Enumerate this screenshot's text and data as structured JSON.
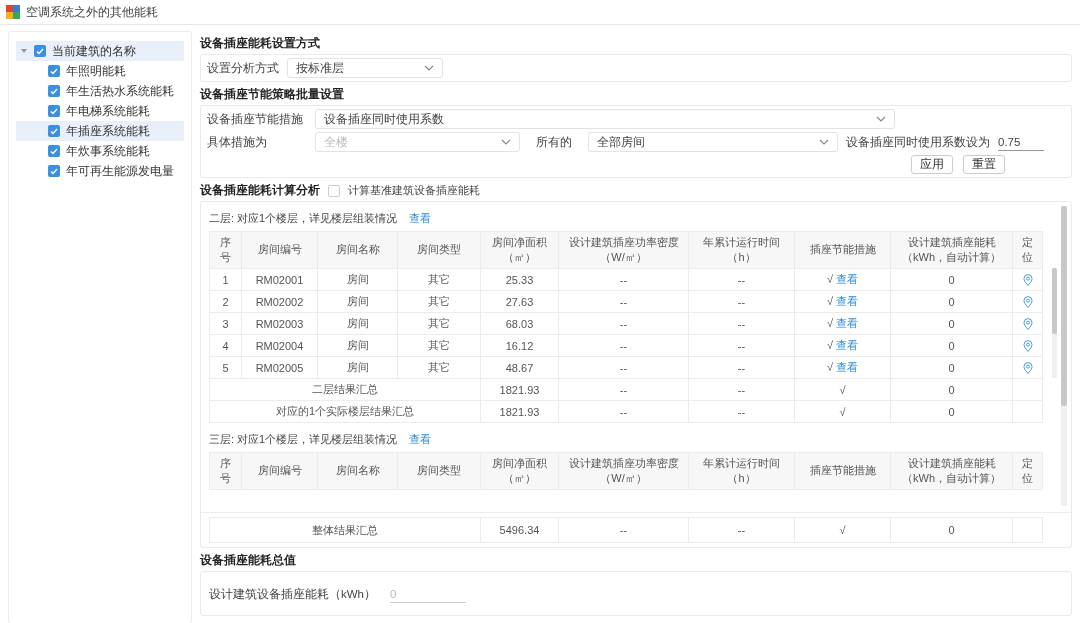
{
  "window": {
    "title": "空调系统之外的其他能耗"
  },
  "tree": {
    "label": "当前建筑的名称",
    "checked": true,
    "expanded": true,
    "selected": true,
    "children": [
      {
        "label": "年照明能耗",
        "checked": true,
        "selected": false
      },
      {
        "label": "年生活热水系统能耗",
        "checked": true,
        "selected": false
      },
      {
        "label": "年电梯系统能耗",
        "checked": true,
        "selected": false
      },
      {
        "label": "年插座系统能耗",
        "checked": true,
        "selected": true
      },
      {
        "label": "年炊事系统能耗",
        "checked": true,
        "selected": false
      },
      {
        "label": "年可再生能源发电量",
        "checked": true,
        "selected": false
      }
    ]
  },
  "setting_mode": {
    "title": "设备插座能耗设置方式",
    "label": "设置分析方式",
    "value": "按标准层"
  },
  "batch": {
    "title": "设备插座节能策略批量设置",
    "measure_label": "设备插座节能措施",
    "measure_value": "设备插座同时使用系数",
    "scope_label": "具体措施为",
    "scope_value": "全楼",
    "scope_disabled": true,
    "rooms_label": "所有的",
    "rooms_value": "全部房间",
    "factor_label": "设备插座同时使用系数设为",
    "factor_value": "0.75",
    "buttons": [
      "应用",
      "重置"
    ]
  },
  "analysis": {
    "title": "设备插座能耗计算分析",
    "baseline_label": "计算基准建筑设备插座能耗",
    "baseline_checked": false,
    "floors": [
      {
        "caption": "二层: 对应1个楼层，详见楼层组装情况",
        "link": "查看",
        "columns": [
          {
            "title": "序号"
          },
          {
            "title": "房间编号"
          },
          {
            "title": "房间名称"
          },
          {
            "title": "房间类型"
          },
          {
            "title": "房间净面积",
            "unit": "（㎡）"
          },
          {
            "title": "设计建筑插座功率密度",
            "unit": "（W/㎡）"
          },
          {
            "title": "年累计运行时间",
            "unit": "（h）"
          },
          {
            "title": "插座节能措施"
          },
          {
            "title": "设计建筑插座能耗",
            "unit": "（kWh，自动计算）"
          },
          {
            "title": "定位"
          }
        ],
        "rows": [
          {
            "no": "1",
            "code": "RM02001",
            "name": "房间",
            "type": "其它",
            "area": "25.33",
            "density": "--",
            "hours": "--",
            "measure": "√",
            "link": "查看",
            "energy": "0"
          },
          {
            "no": "2",
            "code": "RM02002",
            "name": "房间",
            "type": "其它",
            "area": "27.63",
            "density": "--",
            "hours": "--",
            "measure": "√",
            "link": "查看",
            "energy": "0"
          },
          {
            "no": "3",
            "code": "RM02003",
            "name": "房间",
            "type": "其它",
            "area": "68.03",
            "density": "--",
            "hours": "--",
            "measure": "√",
            "link": "查看",
            "energy": "0"
          },
          {
            "no": "4",
            "code": "RM02004",
            "name": "房间",
            "type": "其它",
            "area": "16.12",
            "density": "--",
            "hours": "--",
            "measure": "√",
            "link": "查看",
            "energy": "0"
          },
          {
            "no": "5",
            "code": "RM02005",
            "name": "房间",
            "type": "其它",
            "area": "48.67",
            "density": "--",
            "hours": "--",
            "measure": "√",
            "link": "查看",
            "energy": "0"
          }
        ],
        "summaries": [
          {
            "label": "二层结果汇总",
            "area": "1821.93",
            "density": "--",
            "hours": "--",
            "measure": "√",
            "energy": "0"
          },
          {
            "label": "对应的1个实际楼层结果汇总",
            "area": "1821.93",
            "density": "--",
            "hours": "--",
            "measure": "√",
            "energy": "0"
          }
        ]
      },
      {
        "caption": "三层: 对应1个楼层，详见楼层组装情况",
        "link": "查看",
        "columns": [
          {
            "title": "序号"
          },
          {
            "title": "房间编号"
          },
          {
            "title": "房间名称"
          },
          {
            "title": "房间类型"
          },
          {
            "title": "房间净面积",
            "unit": "（㎡）"
          },
          {
            "title": "设计建筑插座功率密度",
            "unit": "（W/㎡）"
          },
          {
            "title": "年累计运行时间",
            "unit": "（h）"
          },
          {
            "title": "插座节能措施"
          },
          {
            "title": "设计建筑插座能耗",
            "unit": "（kWh，自动计算）"
          },
          {
            "title": "定位"
          }
        ]
      }
    ],
    "total": {
      "label": "整体结果汇总",
      "area": "5496.34",
      "density": "--",
      "hours": "--",
      "measure": "√",
      "energy": "0"
    }
  },
  "total_section": {
    "title": "设备插座能耗总值",
    "label": "设计建筑设备插座能耗（kWh）",
    "value": "0",
    "disabled": true
  }
}
